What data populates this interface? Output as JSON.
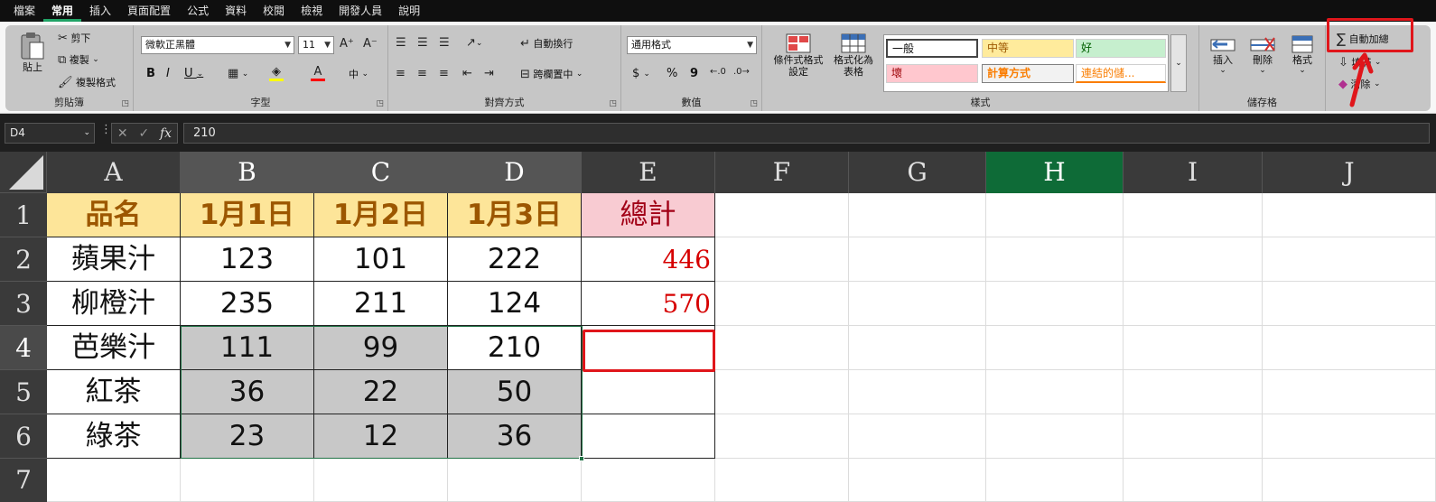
{
  "menu": {
    "tabs": [
      "檔案",
      "常用",
      "插入",
      "頁面配置",
      "公式",
      "資料",
      "校閱",
      "檢視",
      "開發人員",
      "說明"
    ],
    "active": "常用"
  },
  "ribbon": {
    "clipboard": {
      "paste": "貼上",
      "cut": "剪下",
      "copy": "複製",
      "format_painter": "複製格式",
      "label": "剪貼簿"
    },
    "font": {
      "font_name": "微軟正黑體",
      "font_size": "11",
      "bold": "B",
      "italic": "I",
      "underline": "U",
      "grow": "A^",
      "shrink": "Aˇ",
      "phonetic": "中",
      "label": "字型"
    },
    "alignment": {
      "wrap_text": "自動換行",
      "merge_center": "跨欄置中",
      "label": "對齊方式"
    },
    "number": {
      "format": "通用格式",
      "currency": "$",
      "percent": "%",
      "comma": "9",
      "label": "數值"
    },
    "styles": {
      "conditional": "條件式格式設定",
      "format_table": "格式化為表格",
      "cells": [
        {
          "text": "一般",
          "bg": "#ffffff",
          "fg": "#000000"
        },
        {
          "text": "中等",
          "bg": "#ffeb9c",
          "fg": "#9c5700"
        },
        {
          "text": "好",
          "bg": "#c6efce",
          "fg": "#006100"
        },
        {
          "text": "壞",
          "bg": "#ffc7ce",
          "fg": "#9c0006"
        },
        {
          "text": "計算方式",
          "bg": "#f2f2f2",
          "fg": "#fa7d00"
        },
        {
          "text": "連結的儲...",
          "bg": "#ffffff",
          "fg": "#fa7d00"
        }
      ],
      "label": "樣式"
    },
    "cells_group": {
      "insert": "插入",
      "delete": "刪除",
      "format": "格式",
      "label": "儲存格"
    },
    "editing": {
      "autosum": "自動加總",
      "fill": "填滿",
      "clear": "清除"
    }
  },
  "formula_bar": {
    "name_box": "D4",
    "fx": "fx",
    "value": "210"
  },
  "sheet": {
    "columns": [
      "A",
      "B",
      "C",
      "D",
      "E",
      "F",
      "G",
      "H",
      "I",
      "J"
    ],
    "rows": [
      "1",
      "2",
      "3",
      "4",
      "5",
      "6",
      "7"
    ],
    "header": [
      "品名",
      "1月1日",
      "1月2日",
      "1月3日",
      "總計"
    ],
    "data": [
      {
        "name": "蘋果汁",
        "v1": "123",
        "v2": "101",
        "v3": "222",
        "total": "446"
      },
      {
        "name": "柳橙汁",
        "v1": "235",
        "v2": "211",
        "v3": "124",
        "total": "570"
      },
      {
        "name": "芭樂汁",
        "v1": "111",
        "v2": "99",
        "v3": "210",
        "total": ""
      },
      {
        "name": "紅茶",
        "v1": "36",
        "v2": "22",
        "v3": "50",
        "total": ""
      },
      {
        "name": "綠茶",
        "v1": "23",
        "v2": "12",
        "v3": "36",
        "total": ""
      }
    ]
  },
  "colors": {
    "accent": "#21a366",
    "highlight": "#e0161b",
    "header_fill": "#fde599",
    "total_fill": "#f8cbd2",
    "sum_text": "#d60000"
  }
}
